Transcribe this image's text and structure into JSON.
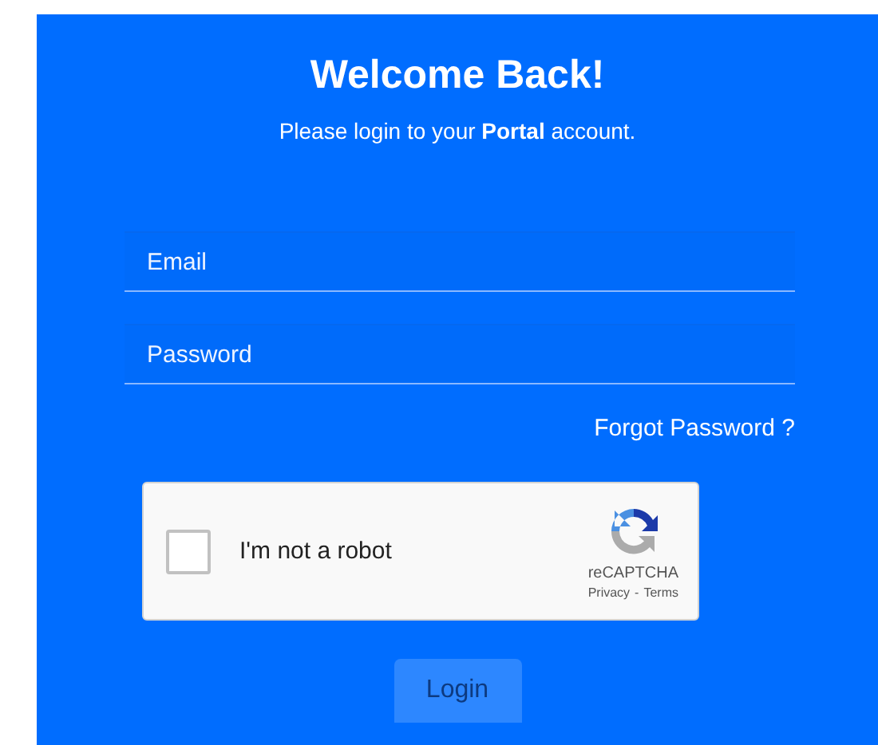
{
  "title": "Welcome Back!",
  "subtitle": "Please login to your **Portal** account.",
  "fields": [
    {
      "placeholder": "Email"
    },
    {
      "placeholder": "Password"
    }
  ],
  "forgot_link": "Forgot Password ?",
  "captcha": {
    "label": "I'm not a robot",
    "checked": false,
    "brand": "reCAPTCHA",
    "privacy": "Privacy",
    "separator": "-",
    "terms": "Terms"
  },
  "login_button": "Login"
}
